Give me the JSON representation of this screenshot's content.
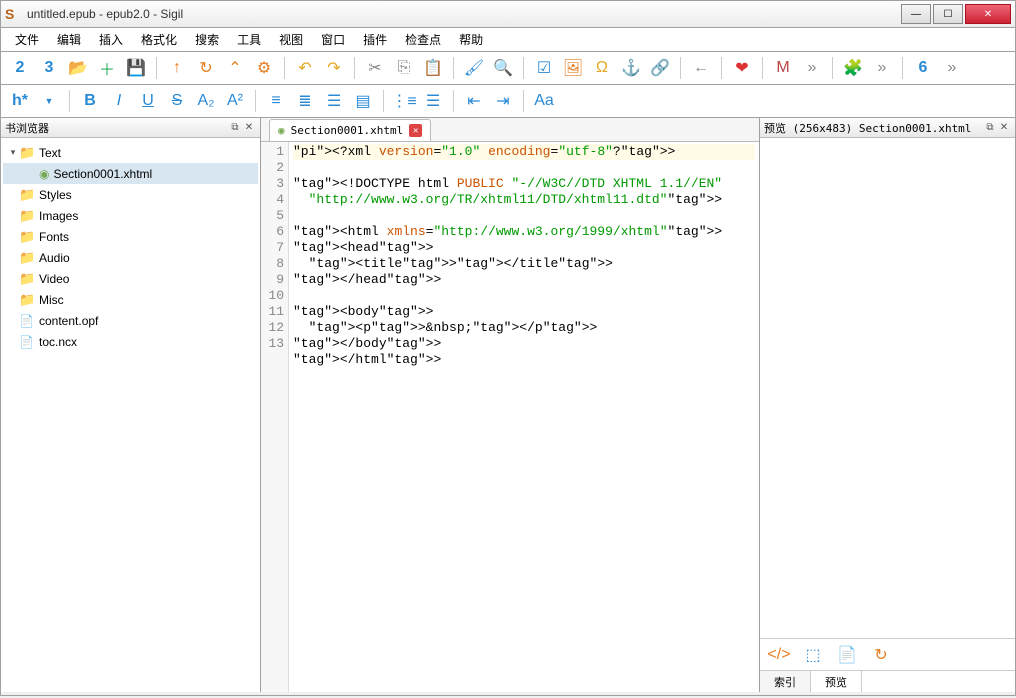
{
  "window": {
    "title": "untitled.epub - epub2.0 - Sigil",
    "app_icon_letter": "S"
  },
  "menu": [
    "文件",
    "编辑",
    "插入",
    "格式化",
    "搜索",
    "工具",
    "视图",
    "窗口",
    "插件",
    "检查点",
    "帮助"
  ],
  "book_browser": {
    "title": "书浏览器",
    "folders": [
      {
        "name": "Text",
        "expanded": true,
        "children": [
          {
            "name": "Section0001.xhtml",
            "selected": true
          }
        ]
      },
      {
        "name": "Styles"
      },
      {
        "name": "Images"
      },
      {
        "name": "Fonts"
      },
      {
        "name": "Audio"
      },
      {
        "name": "Video"
      },
      {
        "name": "Misc"
      }
    ],
    "files": [
      {
        "name": "content.opf"
      },
      {
        "name": "toc.ncx"
      }
    ]
  },
  "editor": {
    "tab_label": "Section0001.xhtml",
    "lines": [
      "<?xml version=\"1.0\" encoding=\"utf-8\"?>",
      "<!DOCTYPE html PUBLIC \"-//W3C//DTD XHTML 1.1//EN\"",
      "  \"http://www.w3.org/TR/xhtml11/DTD/xhtml11.dtd\">",
      "",
      "<html xmlns=\"http://www.w3.org/1999/xhtml\">",
      "<head>",
      "  <title></title>",
      "</head>",
      "",
      "<body>",
      "  <p>&nbsp;</p>",
      "</body>",
      "</html>"
    ]
  },
  "preview": {
    "title": "预览 (256x483) Section0001.xhtml",
    "tabs": [
      "索引",
      "预览"
    ],
    "active_tab": 1
  }
}
